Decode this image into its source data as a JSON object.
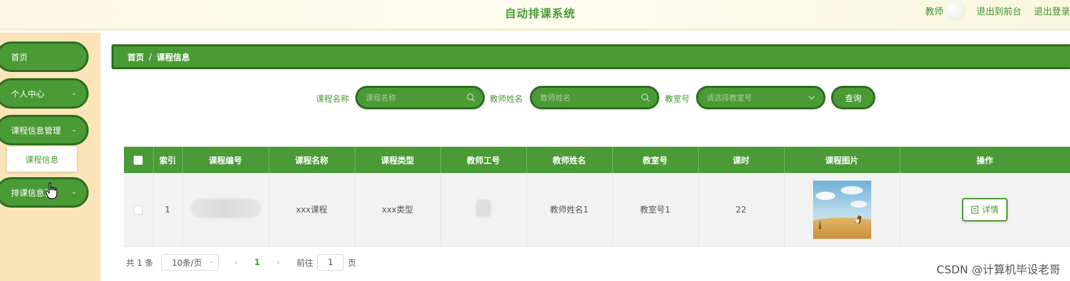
{
  "header": {
    "title": "自动排课系统",
    "role": "教师",
    "links": [
      "退出到前台",
      "退出登录"
    ]
  },
  "sidebar": {
    "items": [
      {
        "label": "首页"
      },
      {
        "label": "个人中心"
      },
      {
        "label": "课程信息管理"
      },
      {
        "label": "排课信息管"
      }
    ],
    "sub_item": "课程信息"
  },
  "breadcrumb": {
    "home": "首页",
    "separator": "/",
    "current": "课程信息"
  },
  "search": {
    "course_name_label": "课程名称",
    "course_name_placeholder": "课程名称",
    "teacher_name_label": "教师姓名",
    "teacher_name_placeholder": "教师姓名",
    "room_label": "教室号",
    "room_placeholder": "请选择教室号",
    "query_button": "查询"
  },
  "table": {
    "columns": [
      "索引",
      "课程编号",
      "课程名称",
      "课程类型",
      "教师工号",
      "教师姓名",
      "教室号",
      "课时",
      "课程图片",
      "操作"
    ],
    "rows": [
      {
        "index": "1",
        "course_name": "xxx课程",
        "course_type": "xxx类型",
        "teacher_name": "教师姓名1",
        "room": "教室号1",
        "hours": "22",
        "action": "详情"
      }
    ]
  },
  "pagination": {
    "total": "共 1 条",
    "page_size": "10条/页",
    "current_page": "1",
    "goto_label": "前往",
    "goto_value": "1",
    "page_suffix": "页"
  },
  "watermark": "CSDN @计算机毕设老哥",
  "colors": {
    "primary": "#4a9a35",
    "primary_dark": "#2d6d20",
    "sidebar_bg": "#fbe4b8",
    "header_bg": "#fbf8e2"
  }
}
